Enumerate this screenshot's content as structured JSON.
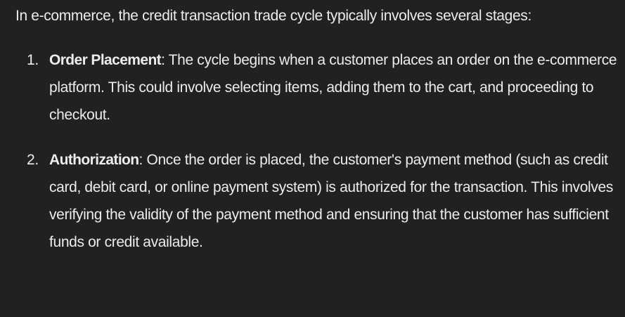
{
  "intro": "In e-commerce, the credit transaction trade cycle typically involves several stages:",
  "items": [
    {
      "number": "1.",
      "term": "Order Placement",
      "text": ": The cycle begins when a customer places an order on the e-commerce platform. This could involve selecting items, adding them to the cart, and proceeding to checkout."
    },
    {
      "number": "2.",
      "term": "Authorization",
      "text": ": Once the order is placed, the customer's payment method (such as credit card, debit card, or online payment system) is authorized for the transaction. This involves verifying the validity of the payment method and ensuring that the customer has sufficient funds or credit available."
    }
  ]
}
